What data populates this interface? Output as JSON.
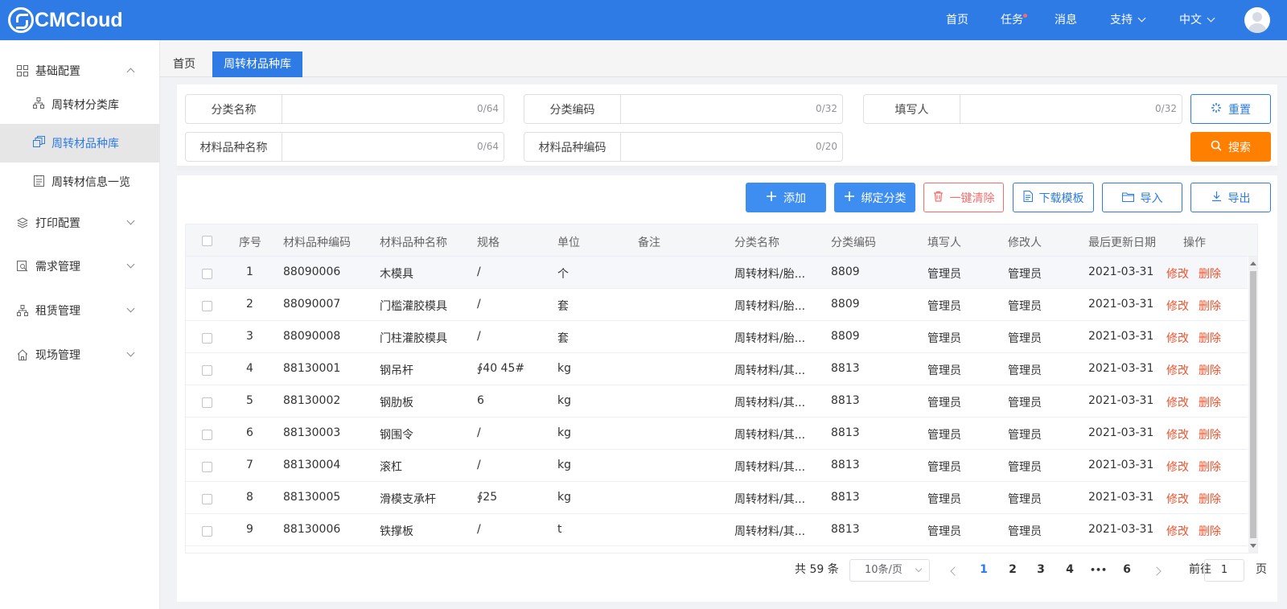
{
  "app": {
    "logo_text": "CMCloud"
  },
  "topnav": {
    "items": [
      "首页",
      "任务",
      "消息",
      "支持",
      "中文"
    ]
  },
  "sidebar": {
    "groups": [
      {
        "label": "基础配置",
        "icon": "grid-icon",
        "expanded": true,
        "children": [
          {
            "label": "周转材分类库",
            "icon": "hierarchy-icon"
          },
          {
            "label": "周转材品种库",
            "icon": "stack-icon",
            "active": true
          },
          {
            "label": "周转材信息一览",
            "icon": "document-list-icon"
          }
        ]
      },
      {
        "label": "打印配置",
        "icon": "layers-icon"
      },
      {
        "label": "需求管理",
        "icon": "search-doc-icon"
      },
      {
        "label": "租赁管理",
        "icon": "hierarchy-icon"
      },
      {
        "label": "现场管理",
        "icon": "home-icon"
      }
    ]
  },
  "tabs": [
    "首页",
    "周转材品种库"
  ],
  "filters": [
    {
      "label": "分类名称",
      "value": "",
      "count": "0/64"
    },
    {
      "label": "分类编码",
      "value": "",
      "count": "0/32"
    },
    {
      "label": "填写人",
      "value": "",
      "count": "0/32"
    },
    {
      "label": "材料品种名称",
      "value": "",
      "count": "0/64"
    },
    {
      "label": "材料品种编码",
      "value": "",
      "count": "0/20"
    }
  ],
  "filter_buttons": {
    "reset": "重置",
    "search": "搜索"
  },
  "toolbar": {
    "add": "添加",
    "bind": "绑定分类",
    "clear": "一键清除",
    "download": "下载模板",
    "import": "导入",
    "export": "导出"
  },
  "table": {
    "headers": [
      "序号",
      "材料品种编码",
      "材料品种名称",
      "规格",
      "单位",
      "备注",
      "分类名称",
      "分类编码",
      "填写人",
      "修改人",
      "最后更新日期",
      "操作"
    ],
    "rows": [
      [
        "1",
        "88090006",
        "木模具",
        "/",
        "个",
        "",
        "周转材料/胎...",
        "8809",
        "管理员",
        "管理员",
        "2021-03-31"
      ],
      [
        "2",
        "88090007",
        "门槛灌胶模具",
        "/",
        "套",
        "",
        "周转材料/胎...",
        "8809",
        "管理员",
        "管理员",
        "2021-03-31"
      ],
      [
        "3",
        "88090008",
        "门柱灌胶模具",
        "/",
        "套",
        "",
        "周转材料/胎...",
        "8809",
        "管理员",
        "管理员",
        "2021-03-31"
      ],
      [
        "4",
        "88130001",
        "钢吊杆",
        "∮40 45#",
        "kg",
        "",
        "周转材料/其...",
        "8813",
        "管理员",
        "管理员",
        "2021-03-31"
      ],
      [
        "5",
        "88130002",
        "钢肋板",
        "6",
        "kg",
        "",
        "周转材料/其...",
        "8813",
        "管理员",
        "管理员",
        "2021-03-31"
      ],
      [
        "6",
        "88130003",
        "钢围令",
        "/",
        "kg",
        "",
        "周转材料/其...",
        "8813",
        "管理员",
        "管理员",
        "2021-03-31"
      ],
      [
        "7",
        "88130004",
        "滚杠",
        "/",
        "kg",
        "",
        "周转材料/其...",
        "8813",
        "管理员",
        "管理员",
        "2021-03-31"
      ],
      [
        "8",
        "88130005",
        "滑模支承杆",
        "∮25",
        "kg",
        "",
        "周转材料/其...",
        "8813",
        "管理员",
        "管理员",
        "2021-03-31"
      ],
      [
        "9",
        "88130006",
        "铁撑板",
        "/",
        "t",
        "",
        "周转材料/其...",
        "8813",
        "管理员",
        "管理员",
        "2021-03-31"
      ]
    ],
    "edit_label": "修改",
    "delete_label": "删除"
  },
  "pagination": {
    "total_text": "共 59 条",
    "page_size": "10条/页",
    "pages": [
      "1",
      "2",
      "3",
      "4",
      "•••",
      "6"
    ],
    "current": "1",
    "goto_label": "前往",
    "goto_value": "1",
    "page_suffix": "页"
  },
  "colors": {
    "brand": "#2e7be6",
    "accent_orange": "#ff7f00",
    "danger": "#f5522d"
  }
}
